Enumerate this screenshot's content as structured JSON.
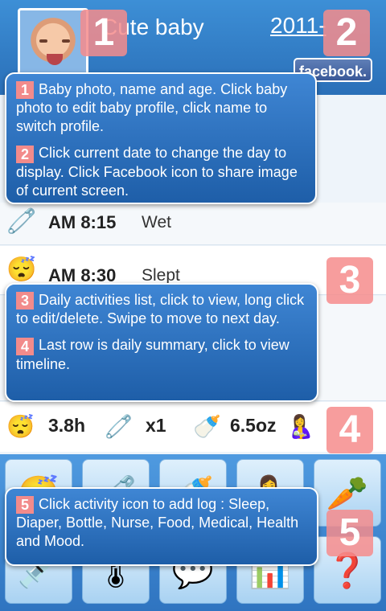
{
  "header": {
    "baby_name": "Cute baby",
    "date": "2011-",
    "facebook_label": "facebook."
  },
  "log_rows": [
    {
      "icon": "diaper-icon",
      "time": "AM 8:15",
      "activity": "Wet"
    },
    {
      "icon": "sleep-baby-icon",
      "time": "AM 8:30",
      "activity": "Slept"
    }
  ],
  "summary": {
    "sleep": "3.8h",
    "diaper": "x1",
    "bottle": "6.5oz"
  },
  "activity_icons": [
    "sleep-icon",
    "diaper-icon",
    "bottle-icon",
    "nurse-icon",
    "food-icon",
    "medical-icon",
    "health-icon",
    "mood-icon",
    "chart-icon",
    "help-icon"
  ],
  "tutorial": {
    "badge1": "1",
    "badge2": "2",
    "badge3": "3",
    "badge4": "4",
    "badge5": "5",
    "tip1": "Baby photo, name and age.  Click baby photo to edit baby profile, click name to switch profile.",
    "tip2": "Click current date to change the day to display. Click Facebook icon to share image of current screen.",
    "tip3": "Daily activities list, click to view, long click to edit/delete. Swipe to move to next day.",
    "tip4": "Last row is daily summary, click to view timeline.",
    "tip5": "Click activity icon to add log : Sleep, Diaper, Bottle, Nurse, Food, Medical, Health and Mood."
  },
  "colors": {
    "header": "#2a6fb8",
    "overlay": "#1e5ea8",
    "badge": "#f28b8b"
  }
}
